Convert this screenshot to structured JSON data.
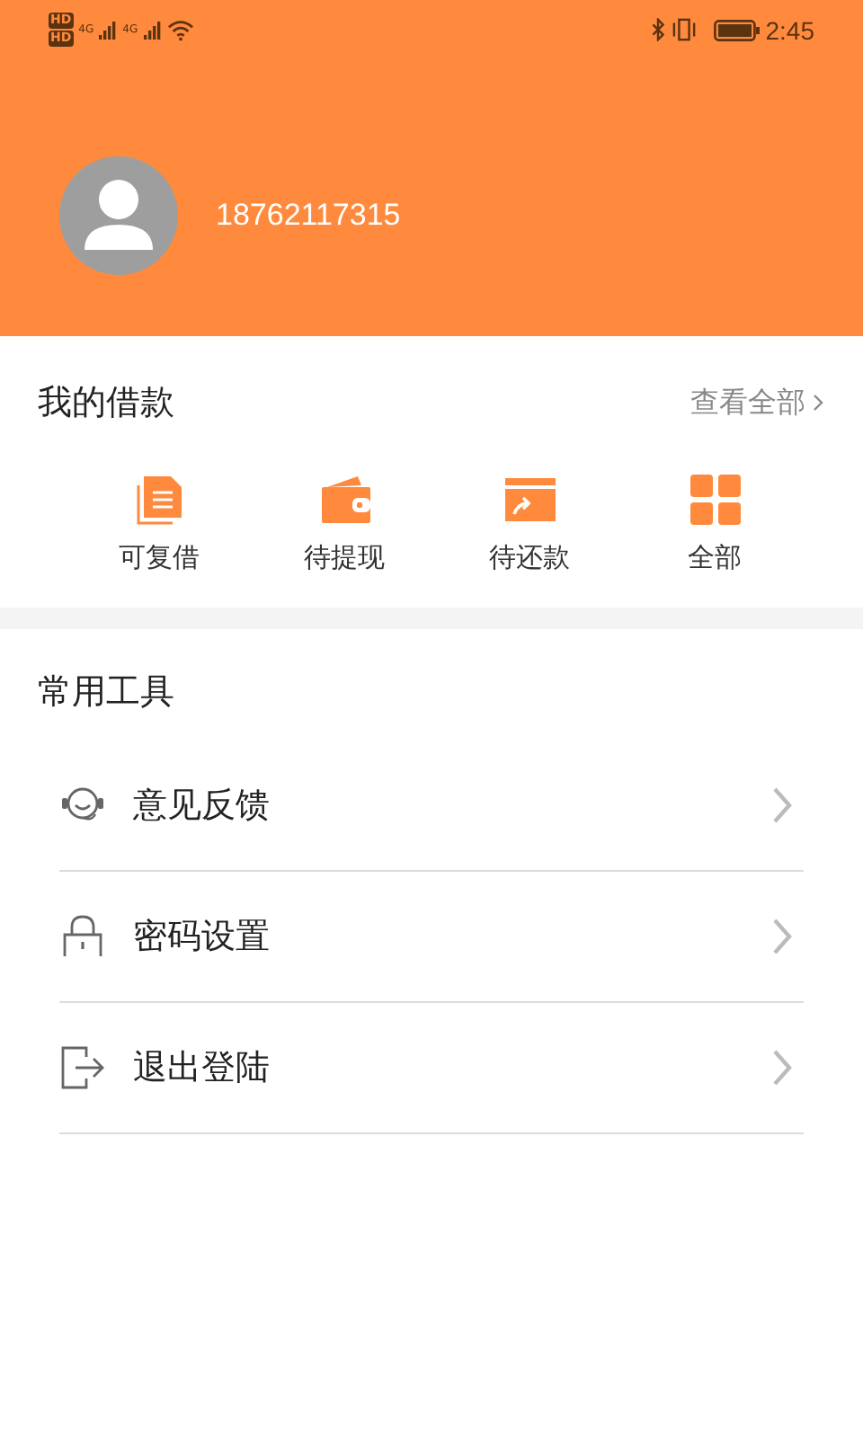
{
  "status_bar": {
    "sims": [
      {
        "badge": "HD",
        "network": "4G"
      },
      {
        "badge": "HD",
        "network": "4G"
      }
    ],
    "time": "2:45"
  },
  "profile": {
    "phone": "18762117315"
  },
  "loans": {
    "title": "我的借款",
    "view_all": "查看全部",
    "items": [
      {
        "label": "可复借"
      },
      {
        "label": "待提现"
      },
      {
        "label": "待还款"
      },
      {
        "label": "全部"
      }
    ]
  },
  "tools": {
    "title": "常用工具",
    "items": [
      {
        "label": "意见反馈"
      },
      {
        "label": "密码设置"
      },
      {
        "label": "退出登陆"
      }
    ]
  }
}
